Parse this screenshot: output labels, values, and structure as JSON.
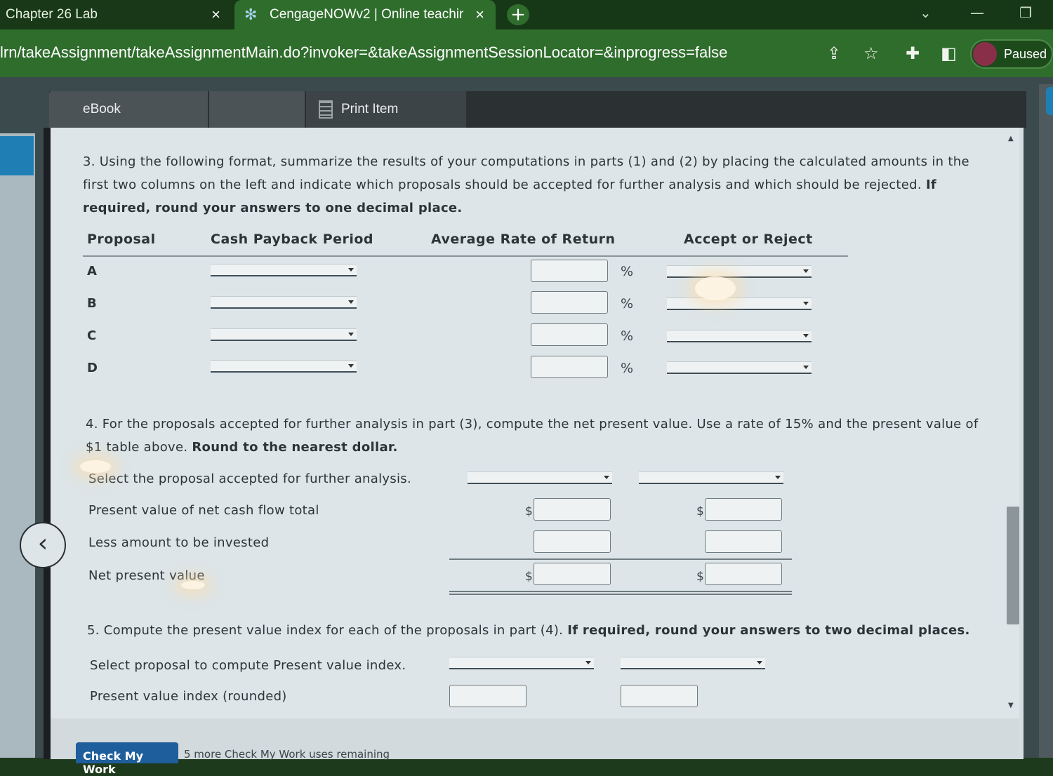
{
  "browser": {
    "tabs": [
      {
        "title": "Chapter 26 Lab",
        "close": "×"
      },
      {
        "title": "CengageNOWv2 | Online teachir",
        "close": "×"
      }
    ],
    "new_tab": "+",
    "url": "lrn/takeAssignment/takeAssignmentMain.do?invoker=&takeAssignmentSessionLocator=&inprogress=false",
    "profile_status": "Paused"
  },
  "nav": {
    "ebook": "eBook",
    "print_item": "Print Item"
  },
  "q3": {
    "text_plain": "3. Using the following format, summarize the results of your computations in parts (1) and (2) by placing the calculated amounts in the first two columns on the left and indicate which proposals should be accepted for further analysis and which should be rejected. ",
    "text_bold": "If required, round your answers to one decimal place.",
    "headers": {
      "proposal": "Proposal",
      "cash_payback": "Cash Payback Period",
      "avg_return": "Average Rate of Return",
      "accept_reject": "Accept or Reject"
    },
    "rows": [
      {
        "proposal": "A",
        "cash_payback": "",
        "avg_return": "",
        "unit": "%",
        "accept_reject": ""
      },
      {
        "proposal": "B",
        "cash_payback": "",
        "avg_return": "",
        "unit": "%",
        "accept_reject": ""
      },
      {
        "proposal": "C",
        "cash_payback": "",
        "avg_return": "",
        "unit": "%",
        "accept_reject": ""
      },
      {
        "proposal": "D",
        "cash_payback": "",
        "avg_return": "",
        "unit": "%",
        "accept_reject": ""
      }
    ]
  },
  "q4": {
    "text_plain": "4. For the proposals accepted for further analysis in part (3), compute the net present value. Use a rate of 15% and the present value of $1 table above. ",
    "text_bold": "Round to the nearest dollar.",
    "select_label": "Select the proposal accepted for further analysis.",
    "pv_label": "Present value of net cash flow total",
    "less_label": "Less amount to be invested",
    "npv_label": "Net present value",
    "currency": "$"
  },
  "q5": {
    "text_plain": "5. Compute the present value index for each of the proposals in part (4). ",
    "text_bold": "If required, round your answers to two decimal places.",
    "select_label": "Select proposal to compute Present value index.",
    "index_label": "Present value index (rounded)"
  },
  "footer": {
    "check_button": "Check My Work",
    "remaining": "5 more Check My Work uses remaining"
  }
}
